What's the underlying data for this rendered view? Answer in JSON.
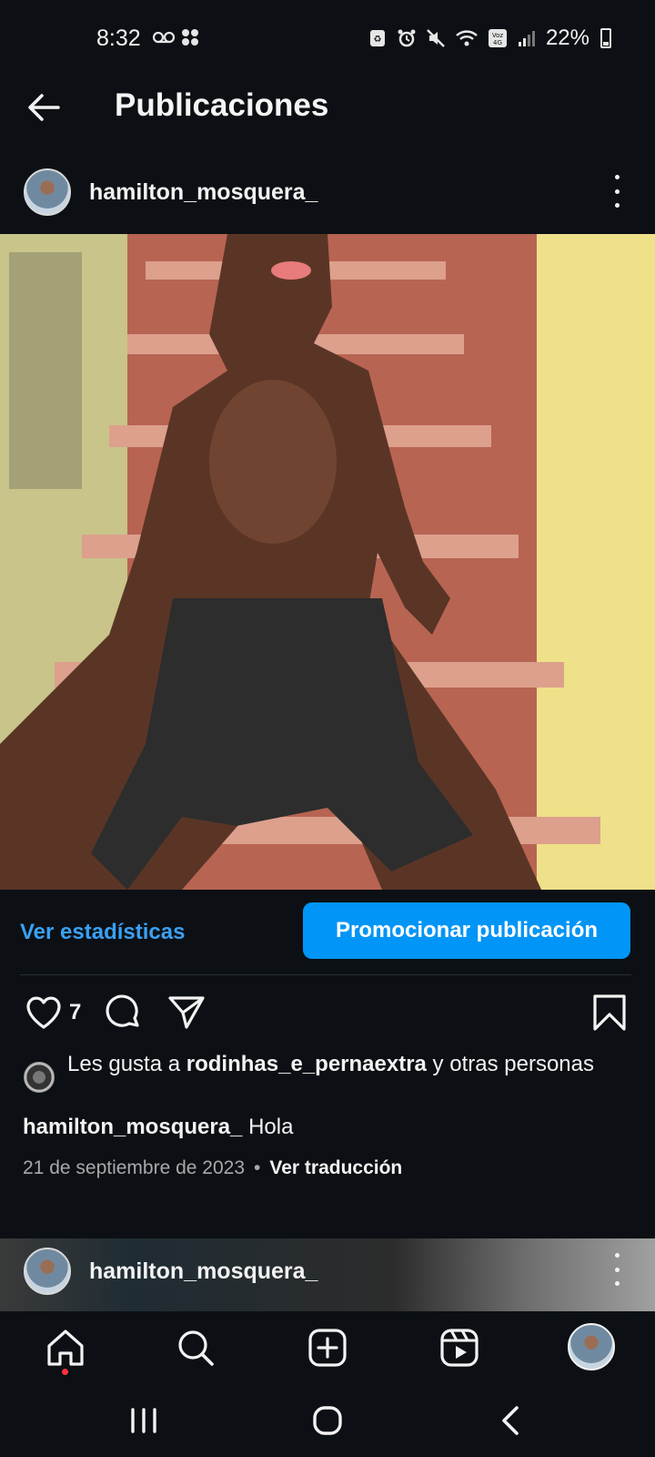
{
  "status_bar": {
    "time": "8:32",
    "left_icons": "voicemail-icon gallery-icon",
    "battery": "22%",
    "network": "Voz 4G"
  },
  "header": {
    "title": "Publicaciones"
  },
  "post": {
    "username": "hamilton_mosquera_",
    "insights_label": "Ver estadísticas",
    "promote_label": "Promocionar publicación",
    "like_count": "7",
    "likes_prefix": "Les gusta a ",
    "likes_user": "rodinhas_e_pernaextra",
    "likes_suffix": " y otras personas",
    "caption_user": "hamilton_mosquera_",
    "caption_text": " Hola",
    "date": "21 de septiembre de 2023",
    "separator": "•",
    "translate_label": "Ver traducción"
  },
  "next_post": {
    "username": "hamilton_mosquera_"
  },
  "icons": {
    "back": "arrow-left-icon",
    "more": "more-vertical-icon",
    "like": "heart-icon",
    "comment": "comment-icon",
    "share": "send-icon",
    "save": "bookmark-icon",
    "nav": [
      "home-icon",
      "search-icon",
      "create-icon",
      "reels-icon",
      "profile-avatar"
    ],
    "system": [
      "recents-icon",
      "home-circle-icon",
      "back-chevron-icon"
    ]
  },
  "colors": {
    "background": "#0c1014",
    "accent": "#0095f6",
    "link": "#3aa0f4",
    "notification": "#ff3040"
  }
}
